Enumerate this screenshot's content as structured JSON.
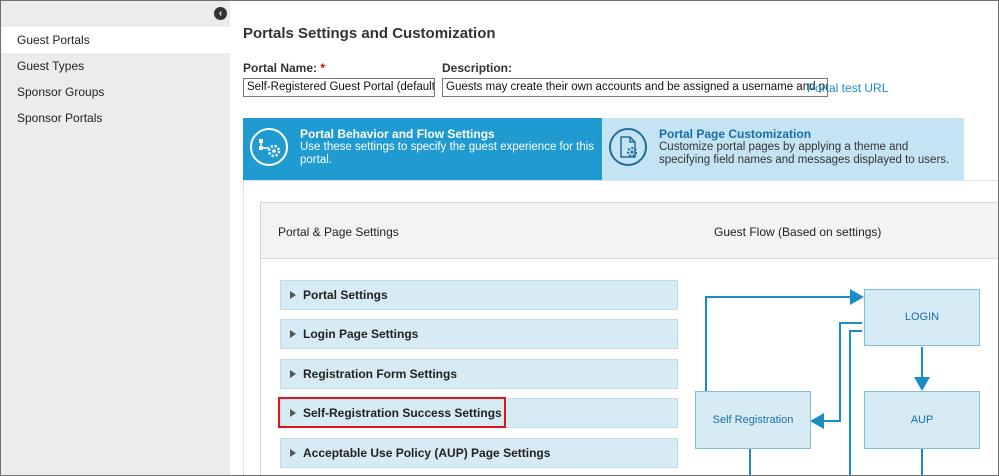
{
  "sidebar": {
    "items": [
      {
        "label": "Guest Portals",
        "active": true
      },
      {
        "label": "Guest Types",
        "active": false
      },
      {
        "label": "Sponsor Groups",
        "active": false
      },
      {
        "label": "Sponsor Portals",
        "active": false
      }
    ],
    "collapse_icon": "chevron-left-icon"
  },
  "main": {
    "title": "Portals Settings and Customization",
    "portal_name_label": "Portal Name:",
    "required_mark": "*",
    "portal_name_value": "Self-Registered Guest Portal (default)",
    "description_label": "Description:",
    "description_value": "Guests may create their own accounts and be assigned a username and password",
    "test_url_label": "Portal test URL"
  },
  "tabs": [
    {
      "title": "Portal Behavior and Flow Settings",
      "desc": "Use these settings to specify the guest experience for this portal.",
      "icon": "flow-settings-icon",
      "active": true
    },
    {
      "title": "Portal Page Customization",
      "desc": "Customize portal pages by applying a theme and specifying field names and messages displayed to users.",
      "icon": "page-customization-icon",
      "active": false
    }
  ],
  "panel": {
    "left_header": "Portal & Page Settings",
    "right_header": "Guest Flow (Based on settings)",
    "accordions": [
      "Portal Settings",
      "Login Page Settings",
      "Registration Form Settings",
      "Self-Registration Success Settings",
      "Acceptable Use Policy (AUP) Page Settings"
    ]
  },
  "flow": {
    "boxes": [
      "LOGIN",
      "Self Registration",
      "AUP"
    ]
  },
  "colors": {
    "accent": "#1f9bd1",
    "tab_inactive": "#c4e4f3",
    "highlight": "#e0151c",
    "flow_line": "#1a8dc4"
  }
}
